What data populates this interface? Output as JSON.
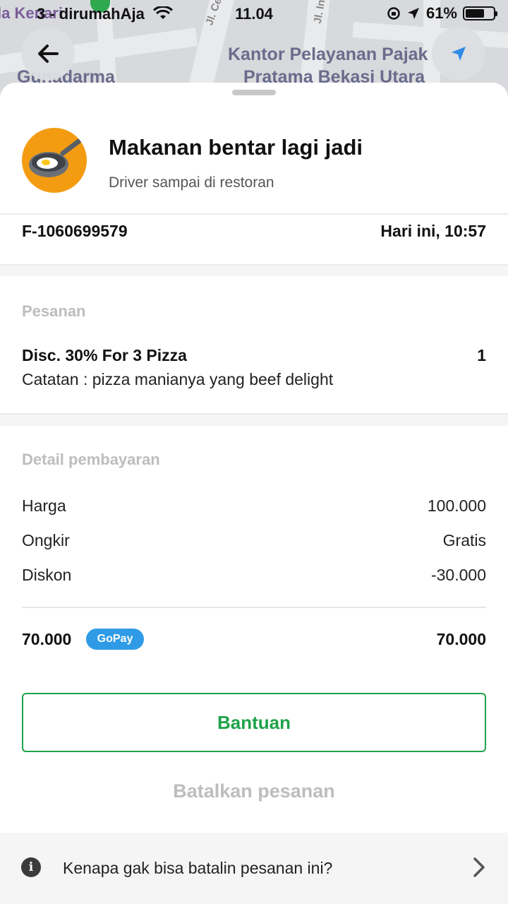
{
  "status_bar": {
    "carrier": "3 - dirumahAja",
    "time": "11.04",
    "battery": "61%"
  },
  "map": {
    "labels": {
      "top_left": "la Kenari",
      "road_1": "Jl. Ce",
      "road_2": "Jl. In",
      "place_1": "Kantor Pelayanan Pajak",
      "place_2": "Pratama Bekasi Utara",
      "place_3": "Gunadarma"
    }
  },
  "order_status": {
    "icon": "frying-pan-egg-icon",
    "title": "Makanan bentar lagi jadi",
    "subtitle": "Driver sampai di restoran"
  },
  "order_info": {
    "id": "F-1060699579",
    "time": "Hari ini, 10:57"
  },
  "order": {
    "section_title": "Pesanan",
    "items": [
      {
        "name": "Disc. 30% For 3 Pizza",
        "qty": "1",
        "note": "Catatan : pizza manianya yang beef delight"
      }
    ]
  },
  "payment": {
    "section_title": "Detail pembayaran",
    "rows": [
      {
        "label": "Harga",
        "value": "100.000"
      },
      {
        "label": "Ongkir",
        "value": "Gratis"
      },
      {
        "label": "Diskon",
        "value": "-30.000"
      }
    ],
    "total_left": "70.000",
    "method": "GoPay",
    "total_right": "70.000"
  },
  "actions": {
    "help": "Bantuan",
    "cancel": "Batalkan pesanan"
  },
  "faq": {
    "text": "Kenapa gak bisa batalin pesanan ini?"
  },
  "colors": {
    "accent_green": "#1ea24a",
    "gopay_blue": "#2f9be6",
    "status_orange": "#f39c12",
    "muted": "#bdbdbd"
  }
}
